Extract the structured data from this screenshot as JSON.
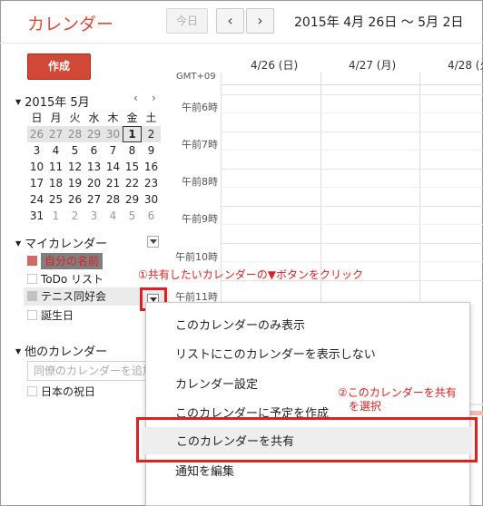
{
  "header": {
    "app_title": "カレンダー",
    "today_label": "今日",
    "prev_glyph": "‹",
    "next_glyph": "›",
    "date_range": "2015年 4月 26日 〜 5月 2日"
  },
  "sidebar": {
    "create_label": "作成",
    "mini_calendar": {
      "title": "2015年 5月",
      "prev_glyph": "‹",
      "next_glyph": "›",
      "weekdays": [
        "日",
        "月",
        "火",
        "水",
        "木",
        "金",
        "土"
      ],
      "weeks": [
        [
          "26",
          "27",
          "28",
          "29",
          "30",
          "1",
          "2"
        ],
        [
          "3",
          "4",
          "5",
          "6",
          "7",
          "8",
          "9"
        ],
        [
          "10",
          "11",
          "12",
          "13",
          "14",
          "15",
          "16"
        ],
        [
          "17",
          "18",
          "19",
          "20",
          "21",
          "22",
          "23"
        ],
        [
          "24",
          "25",
          "26",
          "27",
          "28",
          "29",
          "30"
        ],
        [
          "31",
          "1",
          "2",
          "3",
          "4",
          "5",
          "6"
        ]
      ],
      "selected_day": "1"
    },
    "my_calendars": {
      "title": "マイカレンダー",
      "items": [
        {
          "label": "自分の名前",
          "color": "#d06b64"
        },
        {
          "label": "ToDo リスト"
        },
        {
          "label": "テニス同好会",
          "color": "#c2c2c2"
        },
        {
          "label": "誕生日"
        }
      ]
    },
    "other_calendars": {
      "title": "他のカレンダー",
      "add_placeholder": "同僚のカレンダーを追加",
      "items": [
        {
          "label": "日本の祝日"
        }
      ]
    }
  },
  "grid": {
    "timezone": "GMT+09",
    "days": [
      "4/26 (日)",
      "4/27 (月)",
      "4/28 (火"
    ],
    "times": [
      "午前6時",
      "午前7時",
      "午前8時",
      "午前9時",
      "午前10時",
      "午前11時"
    ]
  },
  "context_menu": {
    "items": [
      "このカレンダーのみ表示",
      "リストにこのカレンダーを表示しない",
      "カレンダー設定",
      "このカレンダーに予定を作成",
      "このカレンダーを共有",
      "通知を編集"
    ],
    "highlighted_index": 4
  },
  "annotations": {
    "step1": "①共有したいカレンダーの▼ボタンをクリック",
    "step2_line1": "②このカレンダーを共有",
    "step2_line2": "を選択",
    "color": "#e02020"
  }
}
